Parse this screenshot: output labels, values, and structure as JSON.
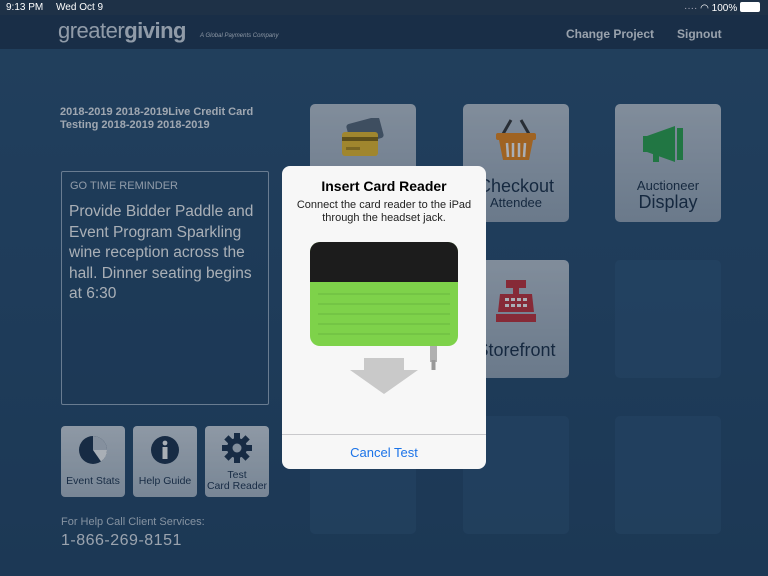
{
  "status_bar": {
    "time": "9:13 PM",
    "date": "Wed Oct 9",
    "battery": "100%"
  },
  "header": {
    "logo_part1": "greater",
    "logo_part2": "giving",
    "tagline": "A Global Payments Company",
    "change_project": "Change Project",
    "signout": "Signout"
  },
  "project_title": "2018-2019 2018-2019Live Credit Card Testing 2018-2019 2018-2019",
  "reminder": {
    "heading": "GO TIME REMINDER",
    "body": "Provide Bidder Paddle and Event Program Sparkling wine reception across the hall. Dinner seating begins at 6:30"
  },
  "small_buttons": {
    "event_stats": "Event Stats",
    "help_guide": "Help Guide",
    "test_line1": "Test",
    "test_line2": "Card Reader"
  },
  "help": {
    "label": "For Help Call Client Services:",
    "phone": "1-866-269-8151"
  },
  "tiles": {
    "checkout_line1": "Checkout",
    "checkout_line2": "Attendee",
    "auctioneer_line1": "Auctioneer",
    "auctioneer_line2": "Display",
    "storefront": "Storefront"
  },
  "dialog": {
    "title": "Insert Card Reader",
    "message": "Connect the card reader to the iPad through the headset jack.",
    "cancel": "Cancel Test"
  },
  "colors": {
    "accent_blue": "#1a73e8",
    "reader_green": "#7ed24a",
    "checkout_orange": "#f08a1c",
    "auctioneer_green": "#2fa84f",
    "storefront_red": "#c9343c"
  }
}
